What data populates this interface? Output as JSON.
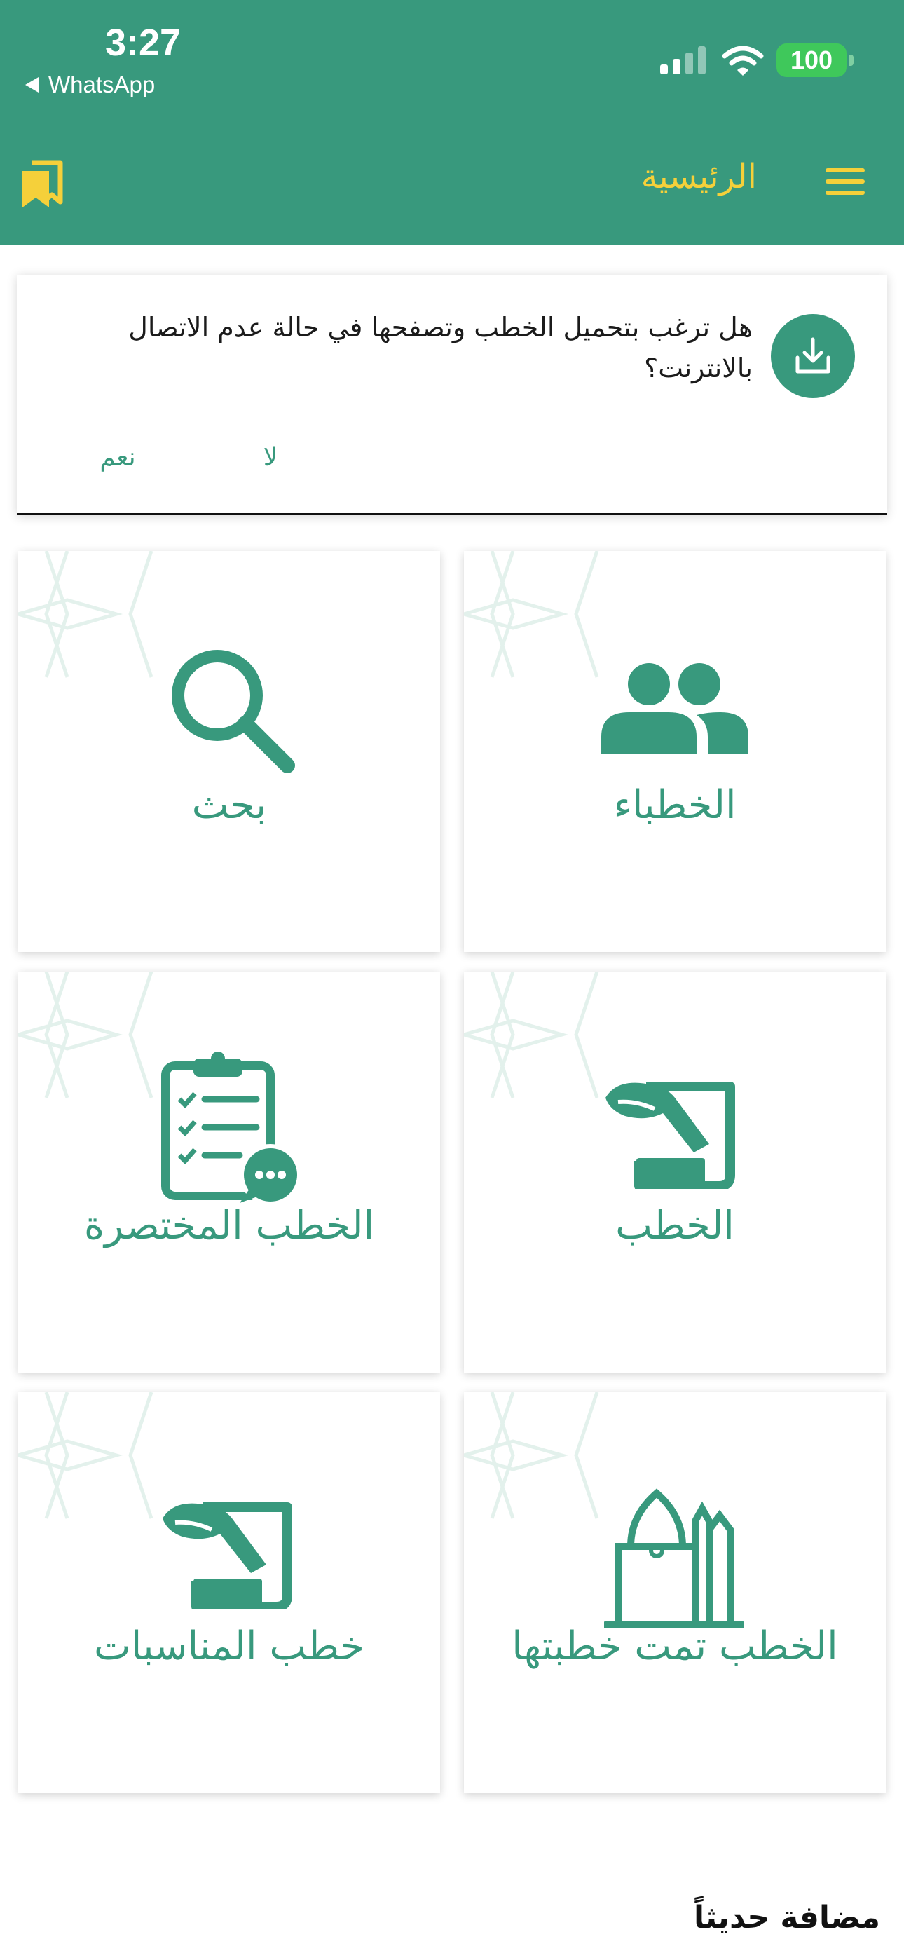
{
  "status_bar": {
    "time": "3:27",
    "back_label": "WhatsApp",
    "battery": "100",
    "signal_icon": "cellular-signal-icon",
    "wifi_icon": "wifi-icon"
  },
  "header": {
    "title": "الرئيسية",
    "menu_icon": "hamburger-menu-icon",
    "bookmark_icon": "bookmarks-icon",
    "background_color": "#38997d",
    "accent_color": "#f5d03a"
  },
  "download_prompt": {
    "icon": "download-icon",
    "message": "هل ترغب بتحميل الخطب وتصفحها في حالة عدم الاتصال بالانترنت؟",
    "no_label": "لا",
    "yes_label": "نعم"
  },
  "tiles": [
    {
      "label": "الخطباء",
      "icon": "people-icon"
    },
    {
      "label": "بحث",
      "icon": "search-icon"
    },
    {
      "label": "الخطب",
      "icon": "sermon-scroll-icon"
    },
    {
      "label": "الخطب المختصرة",
      "icon": "clipboard-checklist-icon"
    },
    {
      "label": "الخطب تمت خطبتها",
      "icon": "mosque-icon"
    },
    {
      "label": "خطب المناسبات",
      "icon": "occasion-scroll-icon"
    }
  ],
  "recent": {
    "title": "مضافة حديثاً"
  }
}
